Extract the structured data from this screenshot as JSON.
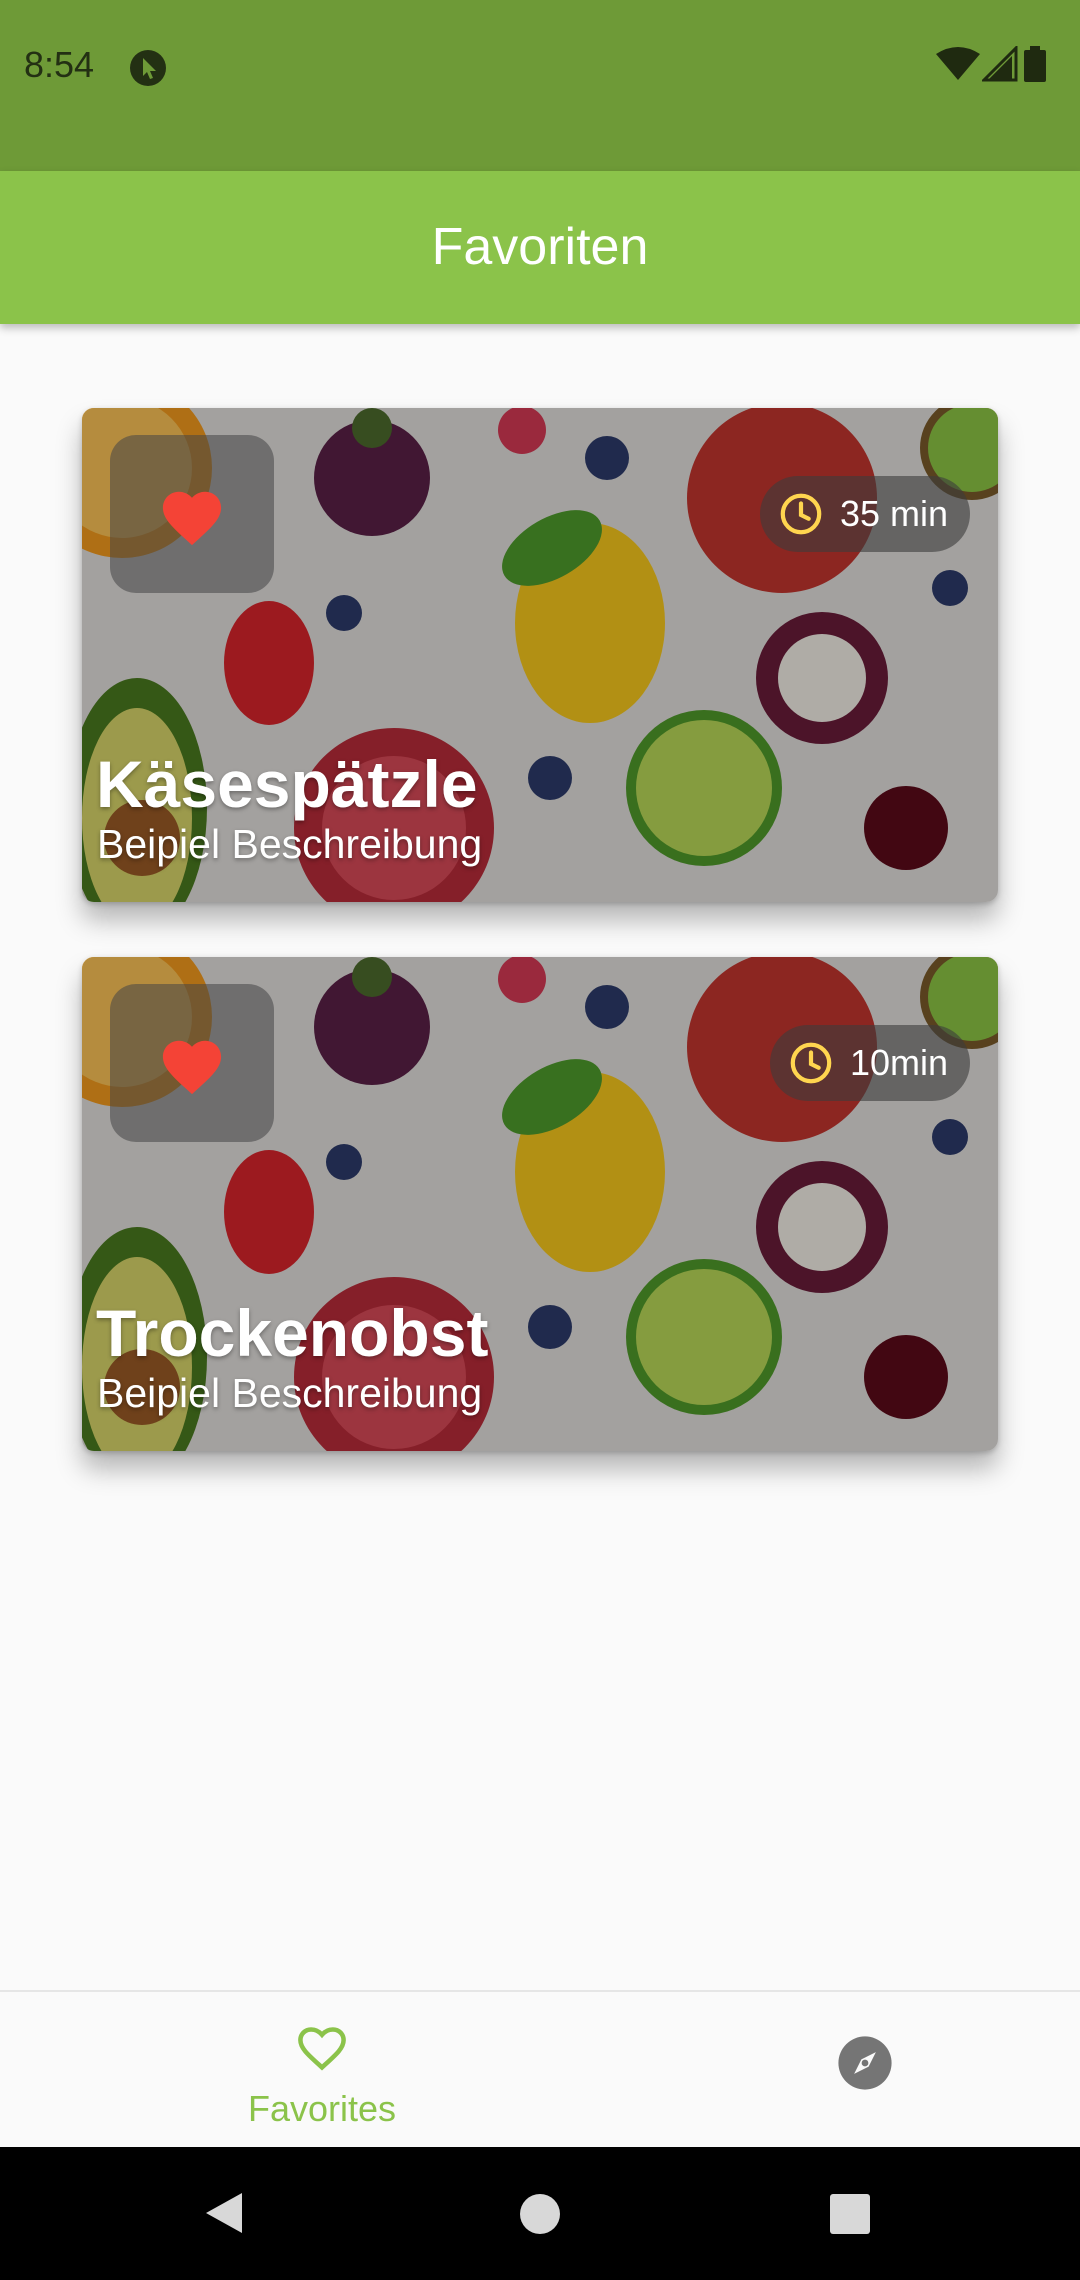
{
  "status_bar": {
    "time": "8:54",
    "app_icon": "cursor-app-icon",
    "icons": [
      "wifi-icon",
      "signal-icon",
      "battery-icon"
    ]
  },
  "app_bar": {
    "title": "Favoriten"
  },
  "recipes": [
    {
      "title": "Käsespätzle",
      "description": "Beipiel Beschreibung",
      "time": "35 min",
      "favorite": true
    },
    {
      "title": "Trockenobst",
      "description": "Beipiel Beschreibung",
      "time": "10min",
      "favorite": true
    }
  ],
  "bottom_nav": {
    "items": [
      {
        "label": "Favorites",
        "icon": "heart-outline-icon",
        "active": true
      },
      {
        "icon": "compass-icon",
        "active": false
      }
    ]
  },
  "colors": {
    "primary": "#8bc34a",
    "status_bar": "#6e9a37",
    "heart": "#f44336",
    "clock": "#ffd54f"
  }
}
